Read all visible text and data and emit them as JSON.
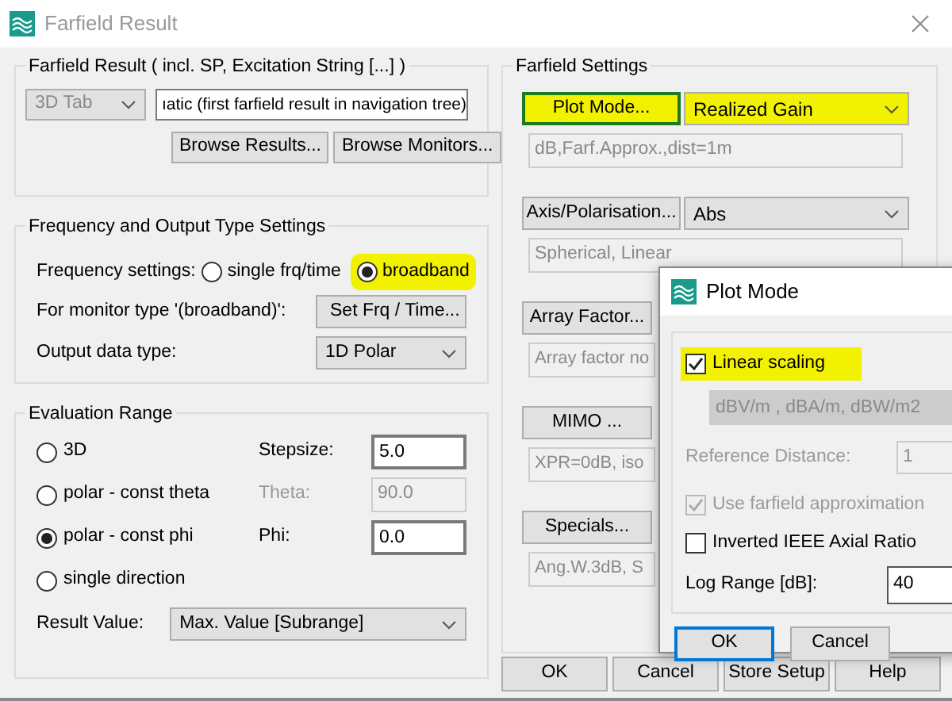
{
  "window": {
    "title": "Farfield Result"
  },
  "farfield_result": {
    "title": "Farfield Result ( incl. SP, Excitation String [...] )",
    "tab_select": {
      "value": "3D Tab",
      "disabled": true
    },
    "result_field": {
      "value": "ıatic (first farfield result in navigation tree)"
    },
    "buttons": [
      "Browse Results...",
      "Browse Monitors..."
    ]
  },
  "frequency": {
    "title": "Frequency and Output Type Settings",
    "frequency_label": "Frequency settings:",
    "options": [
      {
        "label": "single frq/time",
        "selected": false,
        "highlighted": false
      },
      {
        "label": "broadband",
        "selected": true,
        "highlighted": true
      }
    ],
    "monitor_label": "For monitor type '(broadband)':",
    "monitor_button": "Set Frq / Time...",
    "output_label": "Output data type:",
    "output_select": "1D Polar"
  },
  "evaluation": {
    "title": "Evaluation Range",
    "options": [
      {
        "label": "3D",
        "selected": false
      },
      {
        "label": "polar - const theta",
        "selected": false
      },
      {
        "label": "polar - const phi",
        "selected": true
      },
      {
        "label": "single direction",
        "selected": false
      }
    ],
    "fields": [
      {
        "label": "Stepsize:",
        "value": "5.0",
        "disabled": false
      },
      {
        "label": "Theta:",
        "value": "90.0",
        "disabled": true
      },
      {
        "label": "Phi:",
        "value": "0.0",
        "disabled": false
      }
    ],
    "result_label": "Result Value:",
    "result_select": "Max. Value [Subrange]"
  },
  "farfield_settings": {
    "title": "Farfield Settings",
    "rows": [
      {
        "button": "Plot Mode...",
        "select": "Realized Gain",
        "summary": "dB,Farf.Approx.,dist=1m",
        "highlighted": true
      },
      {
        "button": "Axis/Polarisation...",
        "select": "Abs",
        "summary": "Spherical, Linear",
        "highlighted": false
      },
      {
        "button": "Array Factor...",
        "summary": "Array factor no",
        "highlighted": false
      },
      {
        "button": "MIMO ...",
        "summary": "XPR=0dB, iso",
        "highlighted": false
      },
      {
        "button": "Specials...",
        "summary": "Ang.W.3dB, S",
        "highlighted": false
      }
    ]
  },
  "buttons": [
    "OK",
    "Cancel",
    "Store Setup",
    "Help"
  ],
  "plot_mode_dialog": {
    "title": "Plot Mode",
    "linear_scaling": {
      "label": "Linear scaling",
      "checked": true,
      "highlighted": true
    },
    "units_select": "dBV/m , dBA/m,  dBW/m2",
    "reference_label": "Reference Distance:",
    "reference_value": "1",
    "farfield_approx": {
      "label": "Use farfield approximation",
      "checked": true,
      "disabled": true
    },
    "inverted_axial": {
      "label": "Inverted IEEE Axial Ratio",
      "checked": false,
      "disabled": false
    },
    "log_range_label": "Log Range [dB]:",
    "log_range_value": "40",
    "buttons": [
      {
        "label": "OK",
        "focused": true
      },
      {
        "label": "Cancel",
        "focused": false
      }
    ]
  }
}
